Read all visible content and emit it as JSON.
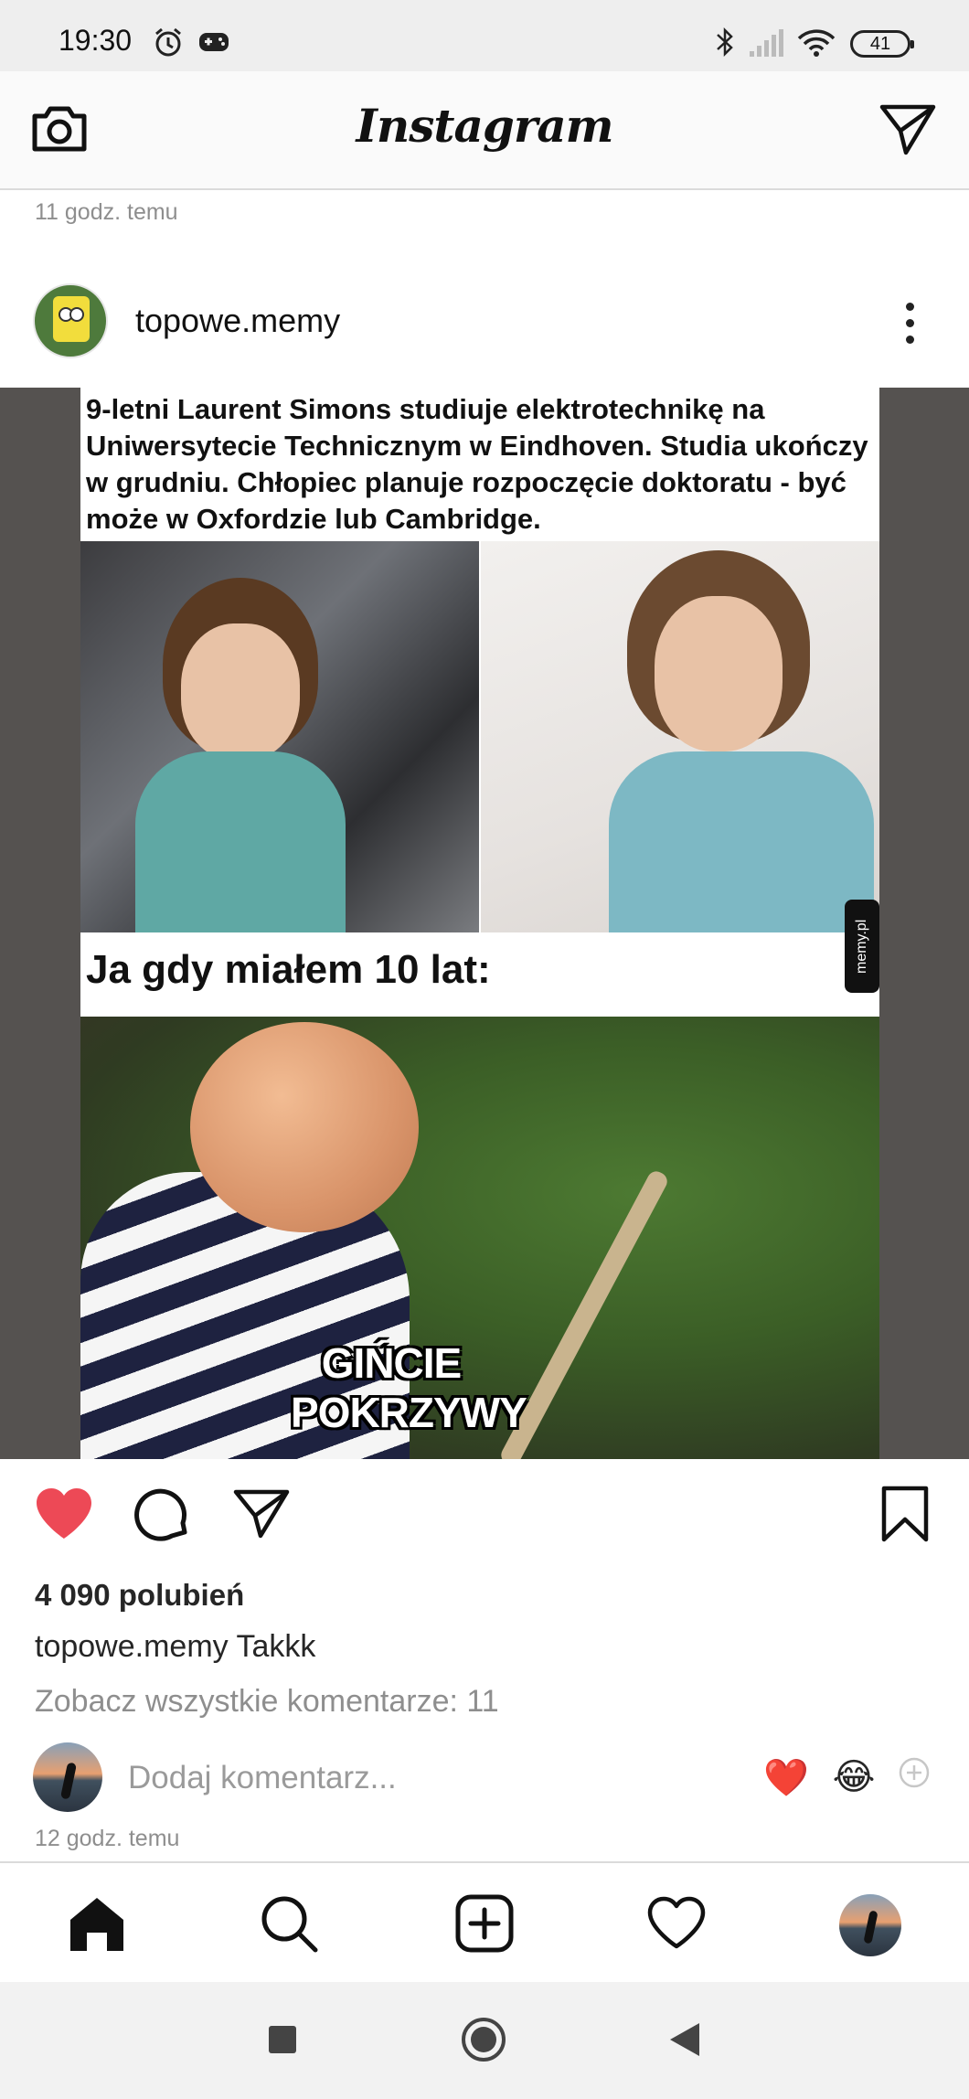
{
  "status_bar": {
    "time": "19:30",
    "battery": "41",
    "icons": [
      "alarm-icon",
      "gamepad-icon",
      "bluetooth-icon",
      "signal-icon",
      "wifi-icon",
      "battery-icon"
    ]
  },
  "header": {
    "logo_text": "Instagram",
    "left_icon": "camera-icon",
    "right_icon": "direct-message-icon"
  },
  "previous_post": {
    "time": "11 godz. temu"
  },
  "post": {
    "username": "topowe.memy",
    "image": {
      "caption_top": "9-letni Laurent Simons studiuje elektrotechnikę na Uniwersytecie Technicznym w Eindhoven. Studia ukończy w grudniu. Chłopiec planuje rozpoczęcie doktoratu - być może w Oxfordzie lub Cambridge.",
      "caption_mid": "Ja gdy miałem 10 lat:",
      "watermark": "memy.pl",
      "bottom_line1": "GIŃCIE",
      "bottom_line2": "POKRZYWY"
    },
    "liked": true,
    "likes": "4 090 polubień",
    "caption_user": "topowe.memy",
    "caption_text": "Takkk",
    "view_comments": "Zobacz wszystkie komentarze: 11",
    "comment_placeholder": "Dodaj komentarz...",
    "quick_reactions": [
      "❤️",
      "😂"
    ],
    "time": "12 godz. temu"
  },
  "colors": {
    "like_red": "#ed4956",
    "text": "#262626",
    "muted": "#8e8e8e"
  },
  "bottom_nav": [
    "home-icon",
    "search-icon",
    "new-post-icon",
    "activity-icon",
    "profile-avatar"
  ],
  "system_nav": [
    "recents-icon",
    "home-circle-icon",
    "back-icon"
  ]
}
